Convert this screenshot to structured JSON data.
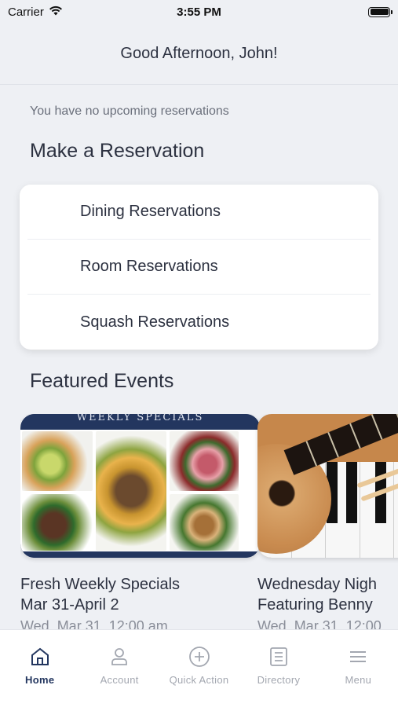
{
  "status_bar": {
    "carrier": "Carrier",
    "time": "3:55 PM",
    "battery_level": 1.0
  },
  "header": {
    "title": "Good Afternoon, John!"
  },
  "upcoming": {
    "text": "You have no upcoming reservations"
  },
  "make_reservation": {
    "title": "Make a Reservation",
    "items": [
      {
        "label": "Dining Reservations"
      },
      {
        "label": "Room Reservations"
      },
      {
        "label": "Squash Reservations"
      }
    ]
  },
  "featured_events": {
    "title": "Featured Events",
    "items": [
      {
        "banner": "WEEKLY SPECIALS",
        "title_line1": "Fresh Weekly Specials",
        "title_line2": "Mar 31-April 2",
        "date": "Wed, Mar 31, 12:00 am"
      },
      {
        "title_line1": "Wednesday Nigh",
        "title_line2": "Featuring Benny",
        "date": "Wed, Mar 31, 12:00"
      }
    ]
  },
  "tabbar": {
    "items": [
      {
        "label": "Home",
        "icon": "home-icon",
        "active": true
      },
      {
        "label": "Account",
        "icon": "account-icon",
        "active": false
      },
      {
        "label": "Quick Action",
        "icon": "plus-circle-icon",
        "active": false
      },
      {
        "label": "Directory",
        "icon": "directory-icon",
        "active": false
      },
      {
        "label": "Menu",
        "icon": "menu-icon",
        "active": false
      }
    ]
  },
  "colors": {
    "primary": "#23365f",
    "background": "#eef0f4",
    "inactive": "#a3a7b0"
  }
}
